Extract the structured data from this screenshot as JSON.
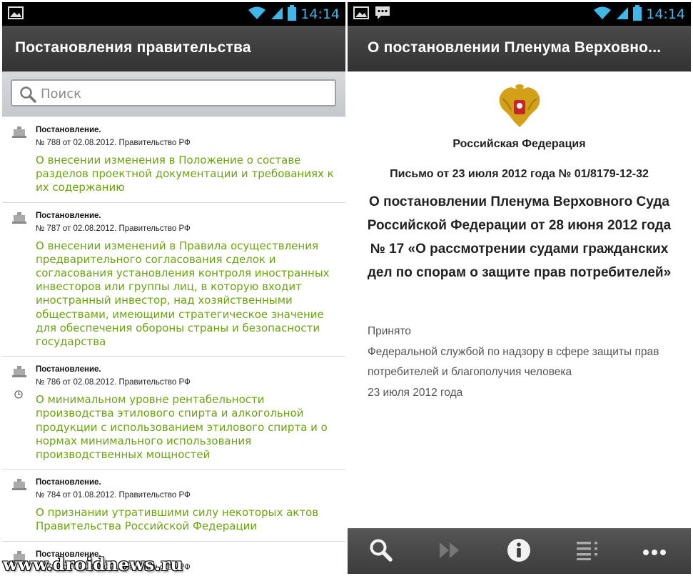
{
  "status": {
    "time": "14:14"
  },
  "left": {
    "title": "Постановления правительства",
    "search_placeholder": "Поиск",
    "items": [
      {
        "kind": "Постановление.",
        "meta": "№ 788 от 02.08.2012. Правительство РФ",
        "title": "О внесении изменения в Положение о составе разделов проектной документации и требованиях к их содержанию"
      },
      {
        "kind": "Постановление.",
        "meta": "№ 787 от 02.08.2012. Правительство РФ",
        "title": "О внесении изменений в Правила осуществления предварительного согласования сделок и согласования установления контроля иностранных инвесторов или группы лиц, в которую входит иностранный инвестор, над хозяйственными обществами, имеющими стратегическое значение для обеспечения обороны страны и безопасности государства"
      },
      {
        "kind": "Постановление.",
        "meta": "№ 786 от 02.08.2012. Правительство РФ",
        "title": "О минимальном уровне рентабельности производства этилового спирта и алкогольной продукции с использованием этилового спирта и о нормах минимального использования производственных мощностей"
      },
      {
        "kind": "Постановление.",
        "meta": "№ 784 от 01.08.2012. Правительство РФ",
        "title": "О признании утратившими силу некоторых актов Правительства Российской Федерации"
      },
      {
        "kind": "Постановление.",
        "meta": "№ 785 от 02.08.2012. Правительство РФ",
        "title": ""
      }
    ]
  },
  "right": {
    "title": "О постановлении Пленума Верховно...",
    "country": "Российская Федерация",
    "letter": "Письмо от 23 июля 2012 года № 01/8179-12-32",
    "heading": "О постановлении Пленума Верховного Суда Российской Федерации от 28 июня 2012 года № 17 «О рассмотрении судами гражданских дел по спорам о защите прав потребителей»",
    "accepted_label": "Принято",
    "accepted_by": "Федеральной службой по надзору в сфере защиты прав потребителей и благополучия человека",
    "accepted_date": "23 июля 2012 года"
  },
  "watermark": "www.droidnews.ru",
  "icons": {
    "status": [
      "image-icon",
      "message-icon",
      "wifi-icon",
      "signal-icon",
      "battery-icon"
    ],
    "toolbar": [
      "search-icon",
      "forward-icon",
      "info-icon",
      "list-icon",
      "more-icon"
    ]
  },
  "colors": {
    "accent_green": "#6aa40e",
    "clock_blue": "#3fb7e8"
  }
}
